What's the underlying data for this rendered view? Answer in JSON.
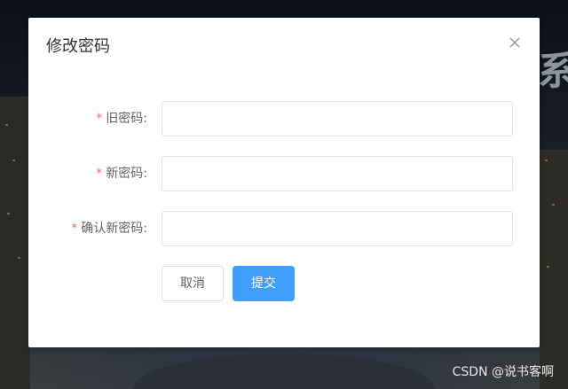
{
  "background": {
    "title_fragment": "系",
    "watermark": "CSDN @说书客啊"
  },
  "dialog": {
    "title": "修改密码",
    "close_icon": "close-icon",
    "fields": [
      {
        "required_mark": "*",
        "label": "旧密码:",
        "value": "",
        "placeholder": ""
      },
      {
        "required_mark": "*",
        "label": "新密码:",
        "value": "",
        "placeholder": ""
      },
      {
        "required_mark": "*",
        "label": "确认新密码:",
        "value": "",
        "placeholder": ""
      }
    ],
    "cancel_label": "取消",
    "submit_label": "提交"
  },
  "colors": {
    "primary": "#409eff",
    "required": "#f56c6c",
    "border": "#dcdfe6",
    "label": "#606266"
  }
}
